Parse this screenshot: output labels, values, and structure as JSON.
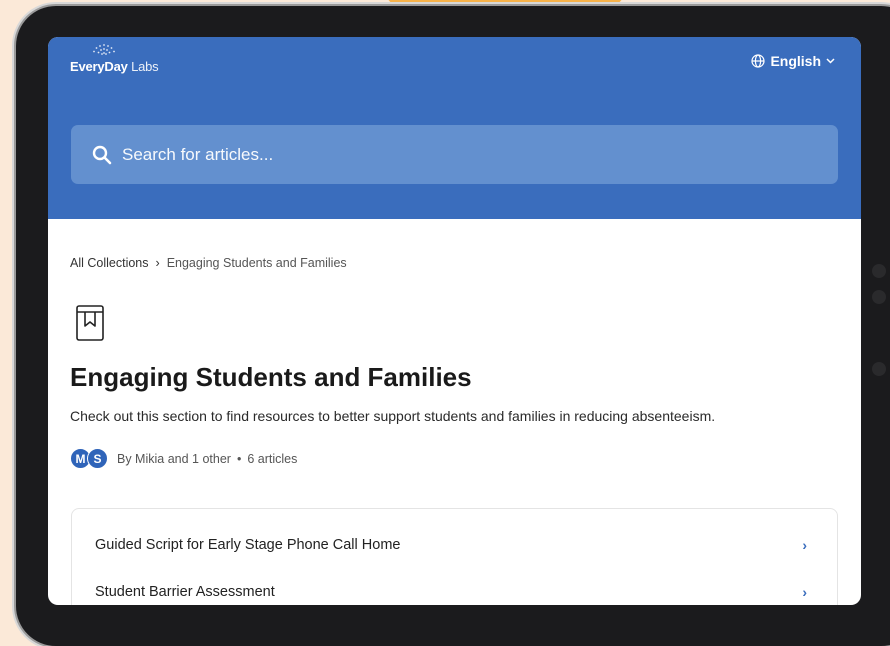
{
  "header": {
    "logo_bold": "EveryDay",
    "logo_light": " Labs",
    "language": "English"
  },
  "search": {
    "placeholder": "Search for articles..."
  },
  "breadcrumb": {
    "root": "All Collections",
    "separator": "›",
    "current": "Engaging Students and Families"
  },
  "collection": {
    "icon": "book-bookmark-icon",
    "title": "Engaging Students and Families",
    "description": "Check out this section to find resources to better support students and families in reducing absenteeism.",
    "avatars": [
      "M",
      "S"
    ],
    "authors": "By Mikia and 1 other",
    "dot": "•",
    "count": "6 articles"
  },
  "articles": [
    {
      "title": "Guided Script for Early Stage Phone Call Home",
      "chevron": "›"
    },
    {
      "title": "Student Barrier Assessment",
      "chevron": "›"
    }
  ],
  "colors": {
    "header_bg": "#3a6dbd",
    "search_bg": "#6390cf",
    "avatar_bg": "#2f64b9",
    "accent": "#3a6dbd",
    "page_bg": "#fbe9d8"
  }
}
